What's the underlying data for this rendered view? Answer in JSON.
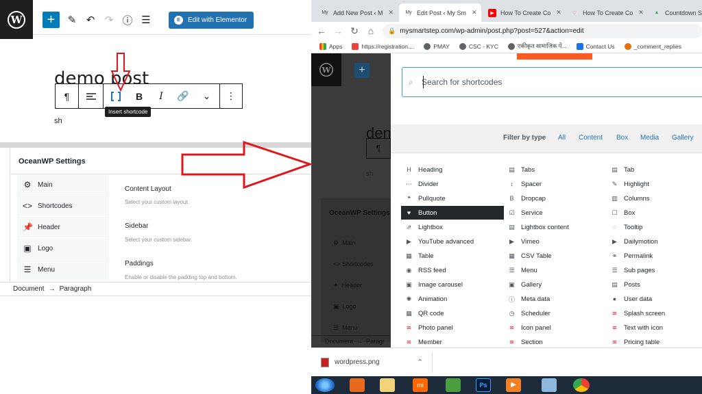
{
  "left_editor": {
    "toolbar": {
      "add_label": "+",
      "edit_with_elementor": "Edit with Elementor"
    },
    "post_title": "demo post",
    "block_toolbar_tooltip": "Insert shortcode",
    "paragraph_text": "sh",
    "metabox": {
      "title": "OceanWP Settings",
      "tabs": [
        {
          "label": "Main",
          "icon": "gear-icon"
        },
        {
          "label": "Shortcodes",
          "icon": "code-icon"
        },
        {
          "label": "Header",
          "icon": "pin-icon"
        },
        {
          "label": "Logo",
          "icon": "image-icon"
        },
        {
          "label": "Menu",
          "icon": "menu-icon"
        }
      ],
      "options": [
        {
          "title": "Content Layout",
          "desc": "Select your custom layout."
        },
        {
          "title": "Sidebar",
          "desc": "Select your custom sidebar."
        },
        {
          "title": "Paddings",
          "desc": "Enable or disable the padding top and bottom."
        }
      ]
    },
    "breadcrumb": {
      "first": "Document",
      "sep": "→",
      "second": "Paragraph"
    }
  },
  "browser": {
    "tabs": [
      {
        "title": "Add New Post ‹ M",
        "active": false
      },
      {
        "title": "Edit Post ‹ My Sm",
        "active": true
      },
      {
        "title": "How To Create Co",
        "active": false
      },
      {
        "title": "How To Create Co",
        "active": false
      },
      {
        "title": "Countdown S",
        "active": false
      }
    ],
    "url": "mysmartstep.com/wp-admin/post.php?post=527&action=edit",
    "bookmarks": [
      "Apps",
      "https://registration....",
      "PMAY",
      "CSC - KYC",
      "एकीकृत सामाजिक पें...",
      "Contact Us",
      "_comment_replies"
    ],
    "dimmed_bg": {
      "title_fragment": "den",
      "paragraph": "sh",
      "metabox_title": "OceanWP Settings",
      "tabs": [
        "Main",
        "Shortcodes",
        "Header",
        "Logo",
        "Menu"
      ],
      "breadcrumb": "Document  →  Paragr"
    },
    "modal": {
      "search_placeholder": "Search for shortcodes",
      "filter_label": "Filter by type",
      "filters": [
        "All",
        "Content",
        "Box",
        "Media",
        "Gallery"
      ],
      "shortcodes": [
        [
          "Heading",
          "Tabs",
          "Tab"
        ],
        [
          "Divider",
          "Spacer",
          "Highlight"
        ],
        [
          "Pullquote",
          "Dropcap",
          "Columns"
        ],
        [
          "Button",
          "Service",
          "Box"
        ],
        [
          "Lightbox",
          "Lightbox content",
          "Tooltip"
        ],
        [
          "YouTube advanced",
          "Vimeo",
          "Dailymotion"
        ],
        [
          "Table",
          "CSV Table",
          "Permalink"
        ],
        [
          "RSS feed",
          "Menu",
          "Sub pages"
        ],
        [
          "Image carousel",
          "Gallery",
          "Posts"
        ],
        [
          "Animation",
          "Meta data",
          "User data"
        ],
        [
          "QR code",
          "Scheduler",
          "Splash screen"
        ],
        [
          "Photo panel",
          "Icon panel",
          "Text with icon"
        ],
        [
          "Member",
          "Section",
          "Pricing table"
        ]
      ],
      "selected": "Button"
    },
    "download": "wordpress.png"
  }
}
